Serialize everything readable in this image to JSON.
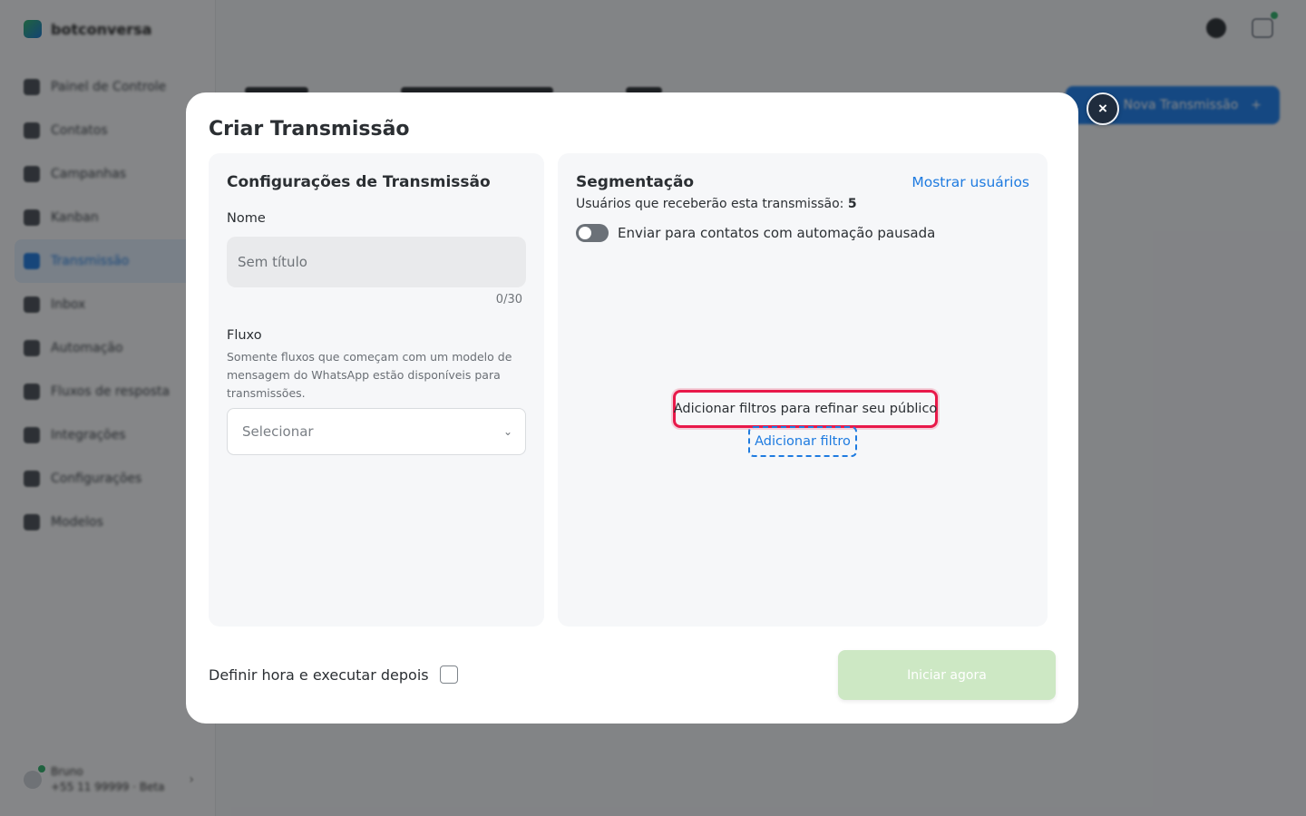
{
  "app": {
    "brand": "botconversa",
    "nav_items": [
      {
        "label": "Painel de Controle",
        "icon": "dashboard-icon"
      },
      {
        "label": "Contatos",
        "icon": "contacts-icon"
      },
      {
        "label": "Campanhas",
        "icon": "campaigns-icon"
      },
      {
        "label": "Kanban",
        "icon": "kanban-icon"
      },
      {
        "label": "Transmissão",
        "icon": "broadcast-icon",
        "active": true
      },
      {
        "label": "Inbox",
        "icon": "inbox-icon"
      },
      {
        "label": "Automação",
        "icon": "automation-icon"
      },
      {
        "label": "Fluxos de resposta",
        "icon": "flows-icon"
      },
      {
        "label": "Integrações",
        "icon": "integrations-icon"
      },
      {
        "label": "Configurações",
        "icon": "settings-icon"
      },
      {
        "label": "Modelos",
        "icon": "templates-icon"
      }
    ],
    "account": {
      "name": "Bruno",
      "detail": "+55 11 99999 · Beta"
    },
    "primary_button": "Nova Transmissão"
  },
  "modal": {
    "title": "Criar Transmissão",
    "close_icon": "×",
    "settings": {
      "title": "Configurações de Transmissão",
      "name_label": "Nome",
      "name_placeholder": "Sem título",
      "name_value": "",
      "counter": "0/30",
      "flow_label": "Fluxo",
      "flow_helper": "Somente fluxos que começam com um modelo de mensagem do WhatsApp estão disponíveis para transmissões.",
      "flow_select": "Selecionar"
    },
    "segmentation": {
      "title": "Segmentação",
      "show_users": "Mostrar usuários",
      "recipients_label": "Usuários que receberão esta transmissão:",
      "recipients_count": "5",
      "paused_toggle_label": "Enviar para contatos com automação pausada",
      "paused_toggle_on": false,
      "filter_hint": "Adicionar filtros para refinar seu público",
      "add_filter": "Adicionar filtro"
    },
    "footer": {
      "schedule_label": "Definir hora e executar depois",
      "schedule_checked": false,
      "start_button": "Iniciar agora"
    }
  },
  "colors": {
    "accent": "#1e7be0",
    "highlight": "#e8194a",
    "start_disabled": "#cde8c4",
    "close_bg": "#1f2c3d"
  }
}
